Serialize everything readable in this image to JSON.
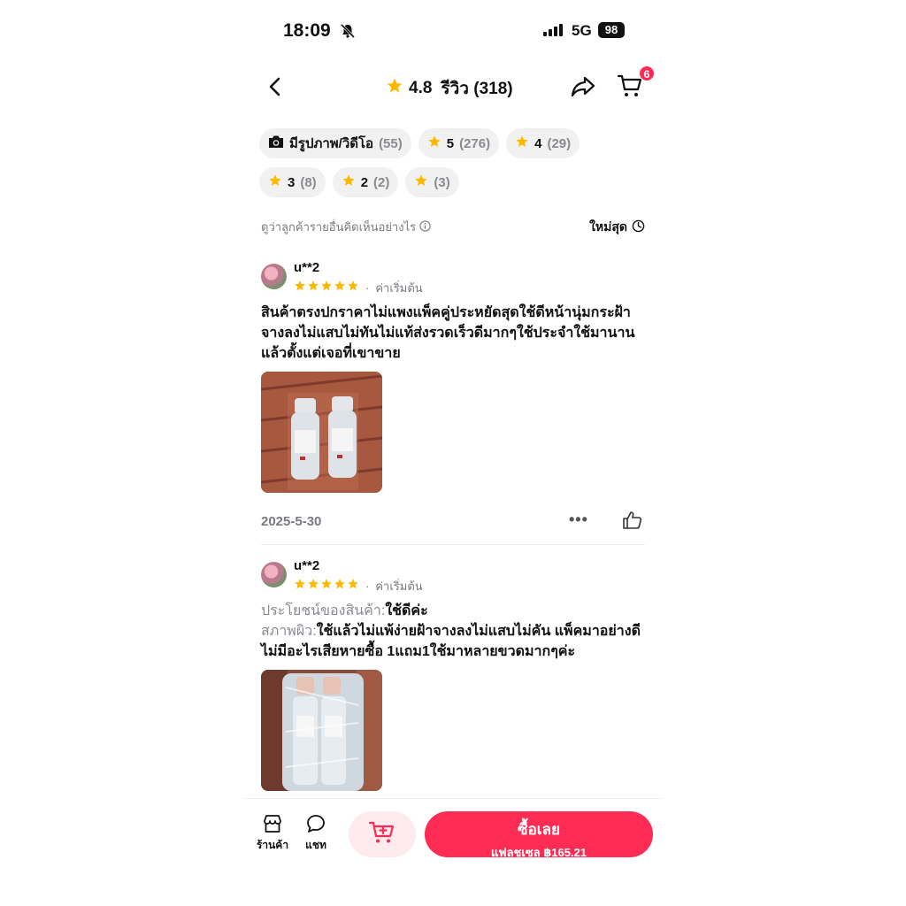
{
  "status": {
    "time": "18:09",
    "network": "5G",
    "battery": "98"
  },
  "header": {
    "rating": "4.8",
    "reviews_label": "รีวิว (318)",
    "cart_count": "6"
  },
  "filters": [
    {
      "label": "มีรูปภาพ/วิดีโอ",
      "count": "(55)",
      "icon": "camera-icon"
    },
    {
      "label": "5",
      "count": "(276)",
      "icon": "star-icon"
    },
    {
      "label": "4",
      "count": "(29)",
      "icon": "star-icon"
    },
    {
      "label": "3",
      "count": "(8)",
      "icon": "star-icon"
    },
    {
      "label": "2",
      "count": "(2)",
      "icon": "star-icon"
    },
    {
      "label": "",
      "count": "(3)",
      "icon": "star-icon"
    }
  ],
  "sort": {
    "hint": "ดูว่าลูกค้ารายอื่นคิดเห็นอย่างไร",
    "newest": "ใหม่สุด"
  },
  "reviews": [
    {
      "user": "u**2",
      "rating": 5,
      "variant": "ค่าเริ่มต้น",
      "text": "สินค้าตรงปกราคาไม่แพงแพ็คคู่ประหยัดสุดใช้ดีหน้านุ่มกระฝ้าจางลงไม่แสบไม่ทันไม่แท้ส่งรวดเร็วดีมากๆใช้ประจำใช้มานานแล้วตั้งแต่เจอที่เขาขาย",
      "date": "2025-5-30"
    },
    {
      "user": "u**2",
      "rating": 5,
      "variant": "ค่าเริ่มต้น",
      "benefit_label": "ประโยชน์ของสินค้า:",
      "benefit_value": "ใช้ดีค่ะ",
      "skin_label": "สภาพผิว:",
      "skin_value": "ใช้แล้วไม่แพ้ง่ายฝ้าจางลงไม่แสบไม่คัน  แพ็คมาอย่างดีไม่มีอะไรเสียหายซื้อ 1แถม1ใช้มาหลายขวดมากๆค่ะ"
    }
  ],
  "bottom": {
    "shop_label": "ร้านค้า",
    "chat_label": "แชท",
    "buy_label": "ซื้อเลย",
    "buy_sub": "แฟลชเซล ฿165.21"
  },
  "colors": {
    "accent": "#fe2c55",
    "star": "#fcb900"
  }
}
